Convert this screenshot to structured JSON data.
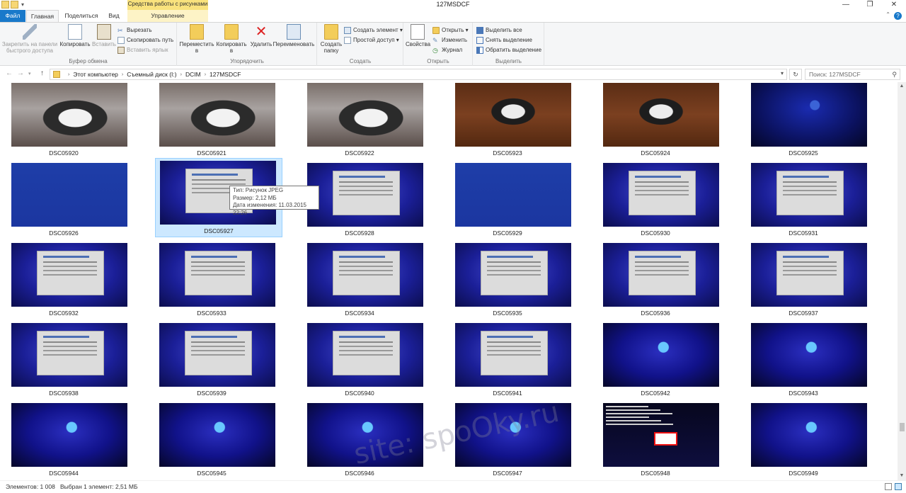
{
  "window": {
    "title": "127MSDCF",
    "context_tab_group": "Средства работы с рисунками",
    "controls": {
      "minimize": "—",
      "maximize": "❐",
      "close": "✕"
    }
  },
  "tabs": {
    "file": "Файл",
    "home": "Главная",
    "share": "Поделиться",
    "view": "Вид",
    "manage": "Управление"
  },
  "ribbon": {
    "clipboard": {
      "label": "Буфер обмена",
      "pin": "Закрепить на панели быстрого доступа",
      "copy": "Копировать",
      "paste": "Вставить",
      "cut": "Вырезать",
      "copy_path": "Скопировать путь",
      "paste_shortcut": "Вставить ярлык"
    },
    "organize": {
      "label": "Упорядочить",
      "move_to": "Переместить в",
      "copy_to": "Копировать в",
      "delete": "Удалить",
      "rename": "Переименовать"
    },
    "create": {
      "label": "Создать",
      "new_folder": "Создать папку",
      "new_item": "Создать элемент",
      "easy_access": "Простой доступ"
    },
    "open": {
      "label": "Открыть",
      "properties": "Свойства",
      "open": "Открыть",
      "edit": "Изменить",
      "history": "Журнал"
    },
    "select": {
      "label": "Выделить",
      "select_all": "Выделить все",
      "select_none": "Снять выделение",
      "invert": "Обратить выделение"
    }
  },
  "address": {
    "crumbs": [
      "Этот компьютер",
      "Съемный диск (I:)",
      "DCIM",
      "127MSDCF"
    ],
    "search_placeholder": "Поиск: 127MSDCF"
  },
  "files": [
    {
      "name": "DSC05920",
      "kind": "cat"
    },
    {
      "name": "DSC05921",
      "kind": "cat"
    },
    {
      "name": "DSC05922",
      "kind": "cat"
    },
    {
      "name": "DSC05923",
      "kind": "cat2"
    },
    {
      "name": "DSC05924",
      "kind": "cat2"
    },
    {
      "name": "DSC05925",
      "kind": "win"
    },
    {
      "name": "DSC05926",
      "kind": "recovery"
    },
    {
      "name": "DSC05927",
      "kind": "dlg",
      "selected": true
    },
    {
      "name": "DSC05928",
      "kind": "dlg"
    },
    {
      "name": "DSC05929",
      "kind": "recovery"
    },
    {
      "name": "DSC05930",
      "kind": "dlg"
    },
    {
      "name": "DSC05931",
      "kind": "dlg"
    },
    {
      "name": "DSC05932",
      "kind": "dlg"
    },
    {
      "name": "DSC05933",
      "kind": "dlg"
    },
    {
      "name": "DSC05934",
      "kind": "dlg"
    },
    {
      "name": "DSC05935",
      "kind": "dlg"
    },
    {
      "name": "DSC05936",
      "kind": "dlg"
    },
    {
      "name": "DSC05937",
      "kind": "dlg"
    },
    {
      "name": "DSC05938",
      "kind": "dlg"
    },
    {
      "name": "DSC05939",
      "kind": "dlg"
    },
    {
      "name": "DSC05940",
      "kind": "dlg"
    },
    {
      "name": "DSC05941",
      "kind": "dlg"
    },
    {
      "name": "DSC05942",
      "kind": "boot"
    },
    {
      "name": "DSC05943",
      "kind": "boot"
    },
    {
      "name": "DSC05944",
      "kind": "boot"
    },
    {
      "name": "DSC05945",
      "kind": "boot"
    },
    {
      "name": "DSC05946",
      "kind": "boot"
    },
    {
      "name": "DSC05947",
      "kind": "boot"
    },
    {
      "name": "DSC05948",
      "kind": "bios"
    },
    {
      "name": "DSC05949",
      "kind": "boot"
    }
  ],
  "tooltip": {
    "type": "Тип: Рисунок JPEG",
    "size": "Размер: 2,12 МБ",
    "modified": "Дата изменения: 11.03.2015 22:26"
  },
  "status": {
    "count": "Элементов: 1 008",
    "selected": "Выбран 1 элемент: 2,51 МБ"
  },
  "watermark": "site: spoOky.ru",
  "colors": {
    "accent": "#1979ca",
    "selection": "#cce8ff",
    "context_tab": "#f9e27d"
  }
}
